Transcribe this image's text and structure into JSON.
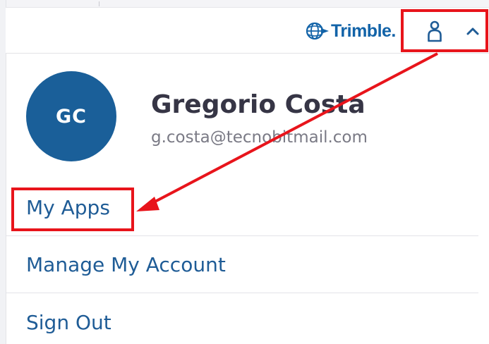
{
  "header": {
    "logo_text": "Trimble.",
    "user_icon": "person-icon",
    "caret_icon": "chevron-up-icon"
  },
  "profile": {
    "initials": "GC",
    "name": "Gregorio Costa",
    "email": "g.costa@tecnobitmail.com"
  },
  "menu": {
    "items": [
      {
        "label": "My Apps"
      },
      {
        "label": "Manage My Account"
      },
      {
        "label": "Sign Out"
      }
    ]
  },
  "colors": {
    "brand": "#1263a8",
    "avatar_bg": "#1a5f99",
    "link": "#1f5c96",
    "annotation": "#e8141b",
    "name": "#363545",
    "email": "#7a7a85"
  }
}
